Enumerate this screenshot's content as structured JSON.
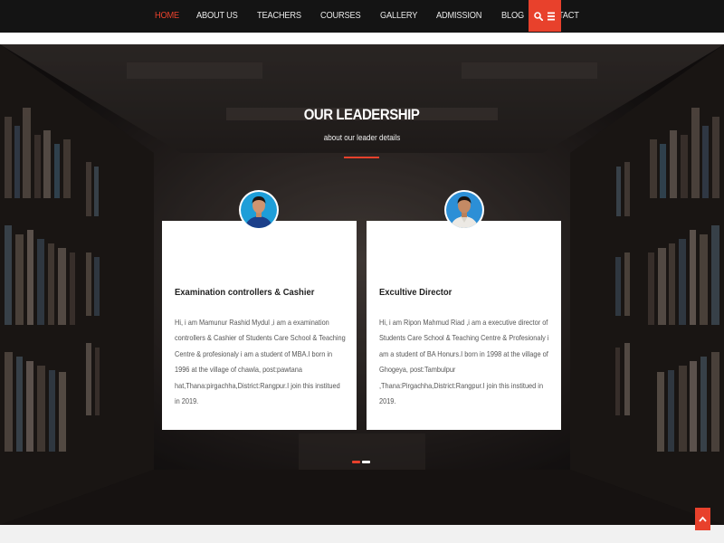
{
  "nav": {
    "items": [
      {
        "label": "HOME",
        "active": true
      },
      {
        "label": "ABOUT US",
        "active": false
      },
      {
        "label": "TEACHERS",
        "active": false
      },
      {
        "label": "COURSES",
        "active": false
      },
      {
        "label": "GALLERY",
        "active": false
      },
      {
        "label": "ADMISSION",
        "active": false
      },
      {
        "label": "BLOG",
        "active": false
      },
      {
        "label": "CONTACT",
        "active": false
      }
    ],
    "icons": [
      "search-icon",
      "menu-icon"
    ]
  },
  "leadership": {
    "title": "OUR LEADERSHIP",
    "subtitle": "about our leader details",
    "cards": [
      {
        "role": "Examination controllers & Cashier",
        "description": "Hi, i am Mamunur Rashid Mydul ,i am a examination controllers & Cashier of Students Care School & Teaching Centre & profesionaly i am a student of MBA.I born in 1996 at the village of chawla, post:pawtana hat,Thana:pirgachha,District:Rangpur.I join this institued in 2019."
      },
      {
        "role": "Excultive Director",
        "description": "Hi, i am Ripon Mahmud Riad ,i am a executive director of Students Care School & Teaching Centre & Profesionaly i am a student of BA Honurs.I born in 1998 at the village of Ghogeya, post:Tambulpur ,Thana:Pirgachha,District:Rangpur.I join this institued in 2019."
      }
    ],
    "carousel": {
      "total": 2,
      "active_index": 0
    }
  },
  "colors": {
    "accent": "#e8412c",
    "navbar": "#141414",
    "card": "#ffffff"
  },
  "scroll_top_icon": "chevron-up-icon"
}
